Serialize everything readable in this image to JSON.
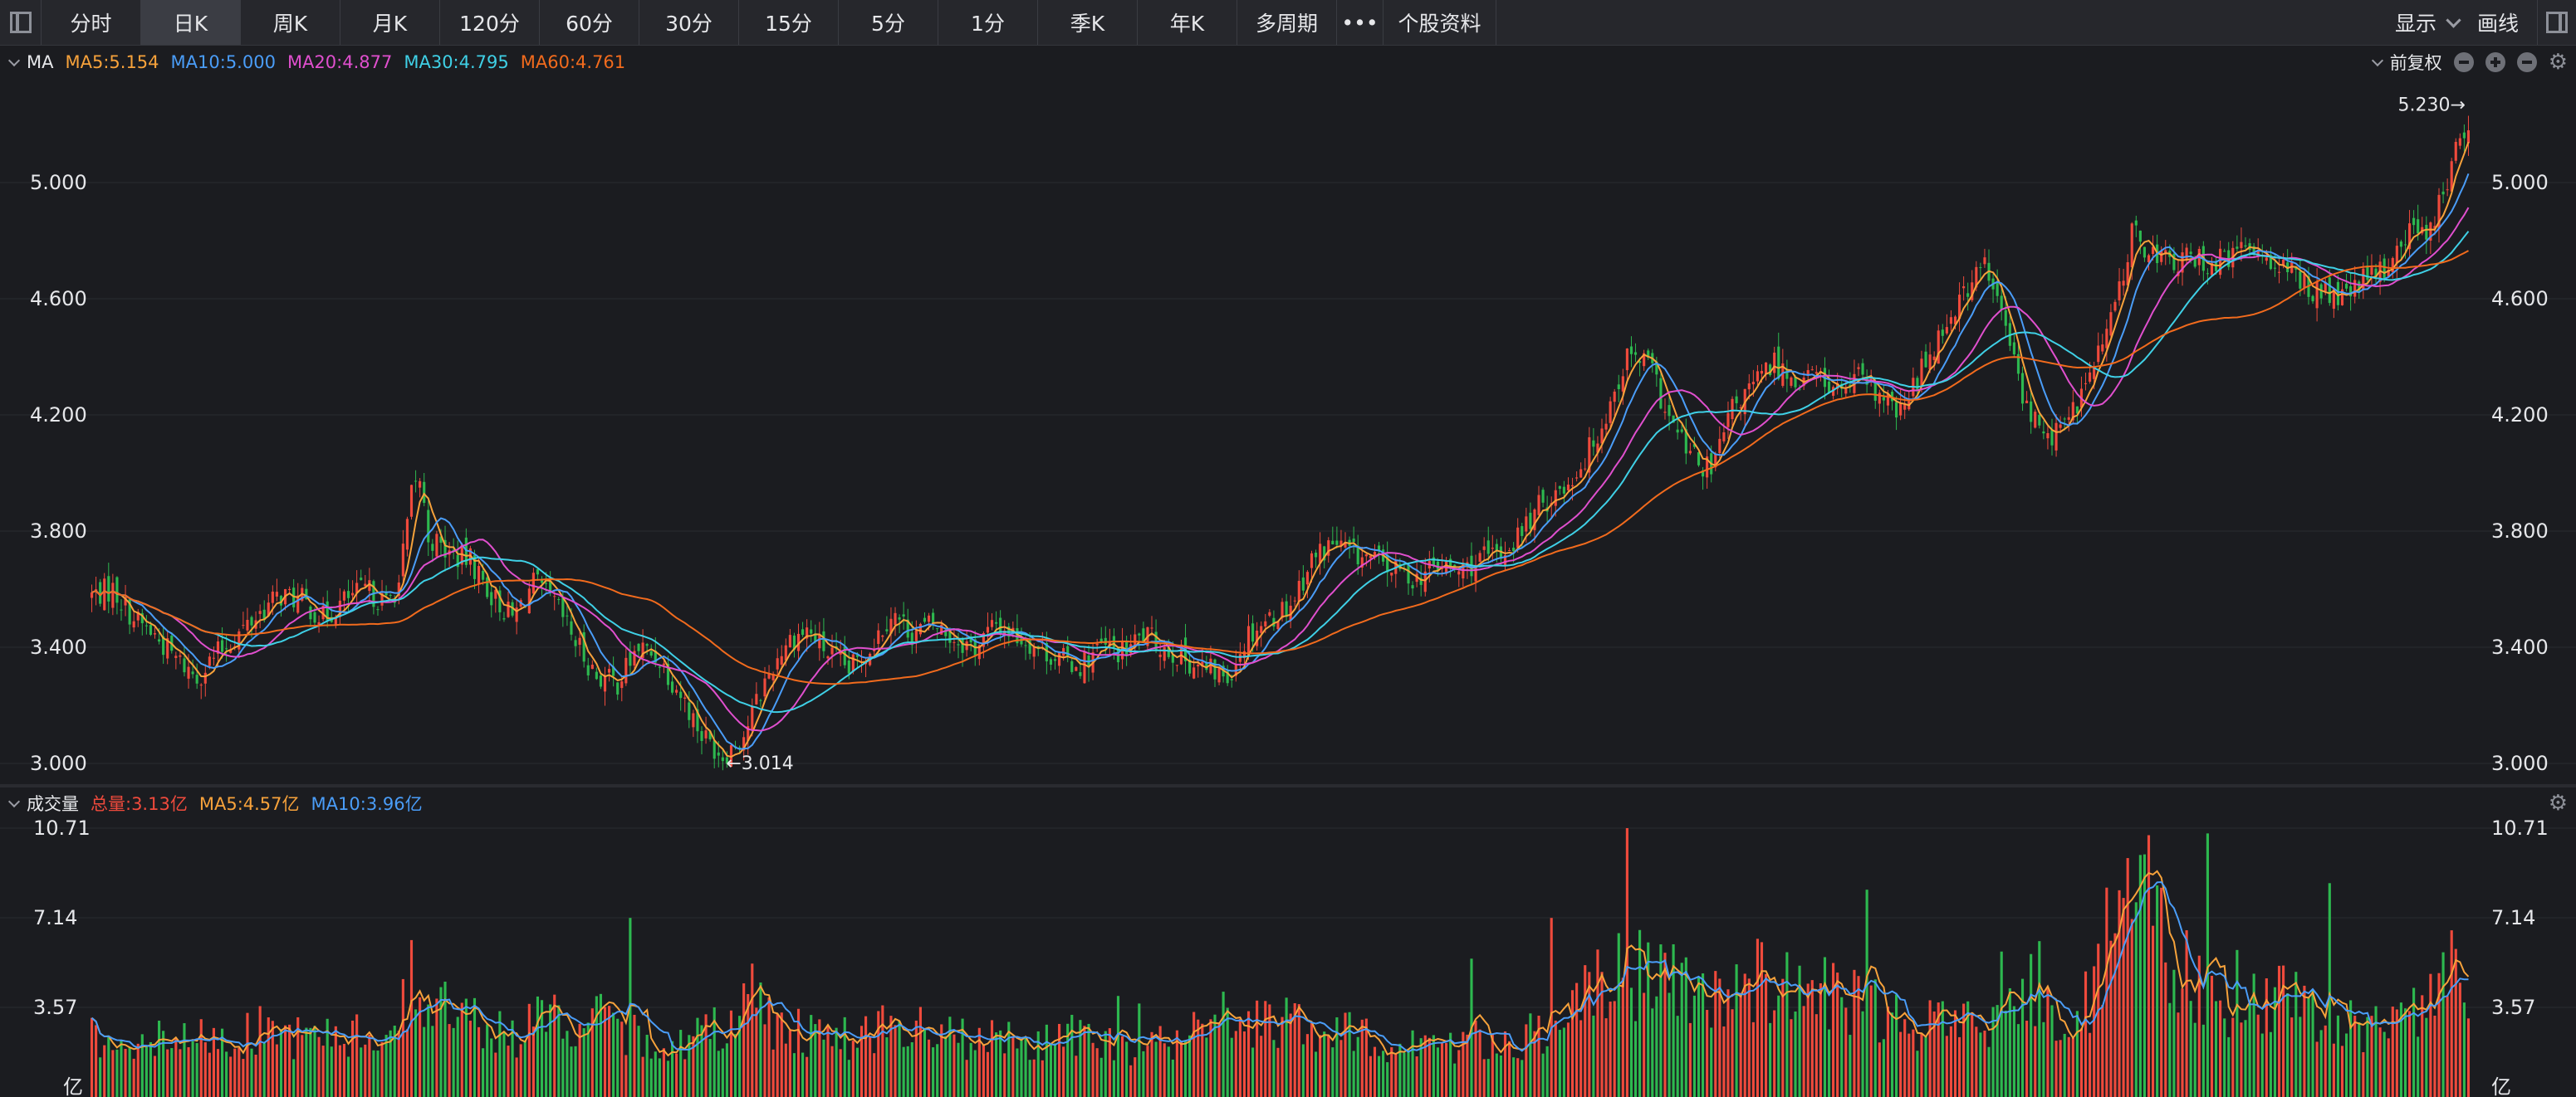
{
  "toolbar": {
    "tabs": [
      "分时",
      "日K",
      "周K",
      "月K",
      "120分",
      "60分",
      "30分",
      "15分",
      "5分",
      "1分",
      "季K",
      "年K",
      "多周期",
      "•••",
      "个股资料"
    ],
    "active_tab": "日K",
    "display_label": "显示",
    "draw_label": "画线"
  },
  "main_legend": {
    "label": "MA",
    "ma5": "MA5:5.154",
    "ma10": "MA10:5.000",
    "ma20": "MA20:4.877",
    "ma30": "MA30:4.795",
    "ma60": "MA60:4.761",
    "adjust": "前复权"
  },
  "volume_legend": {
    "label": "成交量",
    "total": "总量:3.13亿",
    "ma5": "MA5:4.57亿",
    "ma10": "MA10:3.96亿"
  },
  "colors": {
    "up": "#ef4a3c",
    "down": "#2db84f",
    "ma5": "#f7a23b",
    "ma10": "#4a9df8",
    "ma20": "#e04fce",
    "ma30": "#3fd0e6",
    "ma60": "#f26b1d",
    "grid": "#2a2b30",
    "axis_text": "#e6e7ea"
  },
  "chart_data": [
    {
      "type": "candlestick",
      "ylim": [
        3.0,
        5.3
      ],
      "yticks": [
        "5.000",
        "4.600",
        "4.200",
        "3.800",
        "3.400",
        "3.000"
      ],
      "grid": true,
      "annotations": {
        "max_label": "5.230→",
        "min_label": "←3.014",
        "max_value": 5.23,
        "min_value": 3.014
      },
      "series": [
        {
          "name": "MA5",
          "last": 5.154
        },
        {
          "name": "MA10",
          "last": 5.0
        },
        {
          "name": "MA20",
          "last": 4.877
        },
        {
          "name": "MA30",
          "last": 4.795
        },
        {
          "name": "MA60",
          "last": 4.761
        }
      ],
      "close_path": [
        [
          0,
          3.58
        ],
        [
          5,
          3.6
        ],
        [
          10,
          3.5
        ],
        [
          15,
          3.44
        ],
        [
          20,
          3.36
        ],
        [
          25,
          3.3
        ],
        [
          30,
          3.38
        ],
        [
          35,
          3.45
        ],
        [
          40,
          3.52
        ],
        [
          45,
          3.58
        ],
        [
          50,
          3.56
        ],
        [
          55,
          3.5
        ],
        [
          60,
          3.56
        ],
        [
          65,
          3.6
        ],
        [
          70,
          3.55
        ],
        [
          73,
          3.62
        ],
        [
          76,
          3.92
        ],
        [
          78,
          3.98
        ],
        [
          80,
          3.78
        ],
        [
          85,
          3.72
        ],
        [
          90,
          3.7
        ],
        [
          95,
          3.58
        ],
        [
          100,
          3.5
        ],
        [
          105,
          3.62
        ],
        [
          110,
          3.55
        ],
        [
          115,
          3.42
        ],
        [
          120,
          3.3
        ],
        [
          125,
          3.28
        ],
        [
          130,
          3.4
        ],
        [
          135,
          3.36
        ],
        [
          140,
          3.24
        ],
        [
          145,
          3.1
        ],
        [
          150,
          3.03
        ],
        [
          155,
          3.1
        ],
        [
          160,
          3.28
        ],
        [
          165,
          3.42
        ],
        [
          170,
          3.46
        ],
        [
          175,
          3.38
        ],
        [
          180,
          3.32
        ],
        [
          185,
          3.4
        ],
        [
          190,
          3.52
        ],
        [
          195,
          3.45
        ],
        [
          200,
          3.48
        ],
        [
          205,
          3.43
        ],
        [
          210,
          3.4
        ],
        [
          215,
          3.48
        ],
        [
          220,
          3.44
        ],
        [
          225,
          3.4
        ],
        [
          230,
          3.36
        ],
        [
          235,
          3.34
        ],
        [
          240,
          3.4
        ],
        [
          245,
          3.38
        ],
        [
          250,
          3.44
        ],
        [
          255,
          3.4
        ],
        [
          260,
          3.36
        ],
        [
          265,
          3.32
        ],
        [
          270,
          3.3
        ],
        [
          275,
          3.45
        ],
        [
          280,
          3.5
        ],
        [
          285,
          3.55
        ],
        [
          290,
          3.7
        ],
        [
          295,
          3.76
        ],
        [
          300,
          3.72
        ],
        [
          305,
          3.7
        ],
        [
          310,
          3.66
        ],
        [
          315,
          3.64
        ],
        [
          320,
          3.68
        ],
        [
          325,
          3.66
        ],
        [
          330,
          3.7
        ],
        [
          335,
          3.72
        ],
        [
          340,
          3.8
        ],
        [
          345,
          3.9
        ],
        [
          350,
          3.95
        ],
        [
          355,
          4.05
        ],
        [
          360,
          4.2
        ],
        [
          365,
          4.4
        ],
        [
          370,
          4.38
        ],
        [
          375,
          4.18
        ],
        [
          380,
          4.06
        ],
        [
          385,
          4.0
        ],
        [
          390,
          4.22
        ],
        [
          395,
          4.3
        ],
        [
          400,
          4.38
        ],
        [
          405,
          4.32
        ],
        [
          410,
          4.34
        ],
        [
          415,
          4.28
        ],
        [
          420,
          4.32
        ],
        [
          425,
          4.26
        ],
        [
          430,
          4.2
        ],
        [
          435,
          4.36
        ],
        [
          440,
          4.5
        ],
        [
          445,
          4.62
        ],
        [
          450,
          4.72
        ],
        [
          455,
          4.5
        ],
        [
          460,
          4.22
        ],
        [
          465,
          4.12
        ],
        [
          470,
          4.18
        ],
        [
          475,
          4.34
        ],
        [
          480,
          4.52
        ],
        [
          485,
          4.82
        ],
        [
          490,
          4.76
        ],
        [
          495,
          4.72
        ],
        [
          500,
          4.74
        ],
        [
          505,
          4.72
        ],
        [
          510,
          4.76
        ],
        [
          515,
          4.78
        ],
        [
          520,
          4.72
        ],
        [
          525,
          4.66
        ],
        [
          530,
          4.62
        ],
        [
          535,
          4.6
        ],
        [
          540,
          4.66
        ],
        [
          545,
          4.7
        ],
        [
          550,
          4.82
        ],
        [
          555,
          4.84
        ],
        [
          558,
          4.92
        ],
        [
          562,
          5.1
        ],
        [
          565,
          5.2
        ]
      ]
    },
    {
      "type": "bar",
      "unit": "亿",
      "ylim": [
        0,
        10.71
      ],
      "yticks": [
        "10.71",
        "7.14",
        "3.57"
      ],
      "totals_shown": {
        "total": 3.13,
        "ma5": 4.57,
        "ma10": 3.96
      },
      "volume_path": [
        [
          0,
          2.4
        ],
        [
          20,
          2.2
        ],
        [
          40,
          2.6
        ],
        [
          60,
          2.3
        ],
        [
          73,
          2.8
        ],
        [
          76,
          5.0
        ],
        [
          80,
          3.8
        ],
        [
          90,
          3.0
        ],
        [
          100,
          2.5
        ],
        [
          110,
          3.2
        ],
        [
          120,
          3.0
        ],
        [
          130,
          2.4
        ],
        [
          140,
          2.0
        ],
        [
          150,
          3.0
        ],
        [
          157,
          4.2
        ],
        [
          160,
          3.2
        ],
        [
          170,
          2.6
        ],
        [
          180,
          2.4
        ],
        [
          190,
          2.8
        ],
        [
          200,
          2.5
        ],
        [
          210,
          2.3
        ],
        [
          220,
          2.2
        ],
        [
          230,
          2.4
        ],
        [
          240,
          2.2
        ],
        [
          250,
          2.0
        ],
        [
          260,
          2.3
        ],
        [
          270,
          3.2
        ],
        [
          280,
          3.0
        ],
        [
          290,
          2.6
        ],
        [
          300,
          2.4
        ],
        [
          310,
          2.2
        ],
        [
          320,
          2.0
        ],
        [
          330,
          2.3
        ],
        [
          340,
          2.4
        ],
        [
          350,
          2.8
        ],
        [
          355,
          3.8
        ],
        [
          360,
          4.5
        ],
        [
          365,
          5.2
        ],
        [
          370,
          4.6
        ],
        [
          375,
          4.8
        ],
        [
          380,
          4.0
        ],
        [
          390,
          4.4
        ],
        [
          400,
          4.6
        ],
        [
          410,
          4.2
        ],
        [
          420,
          3.6
        ],
        [
          430,
          3.2
        ],
        [
          440,
          2.8
        ],
        [
          450,
          2.9
        ],
        [
          455,
          5.0
        ],
        [
          460,
          4.4
        ],
        [
          465,
          3.8
        ],
        [
          470,
          3.0
        ],
        [
          475,
          4.0
        ],
        [
          480,
          6.8
        ],
        [
          485,
          8.2
        ],
        [
          490,
          7.4
        ],
        [
          495,
          5.5
        ],
        [
          500,
          4.4
        ],
        [
          505,
          3.6
        ],
        [
          510,
          3.2
        ],
        [
          520,
          4.0
        ],
        [
          530,
          3.0
        ],
        [
          540,
          2.8
        ],
        [
          550,
          3.2
        ],
        [
          555,
          3.8
        ],
        [
          560,
          4.4
        ],
        [
          565,
          4.3
        ]
      ]
    }
  ]
}
